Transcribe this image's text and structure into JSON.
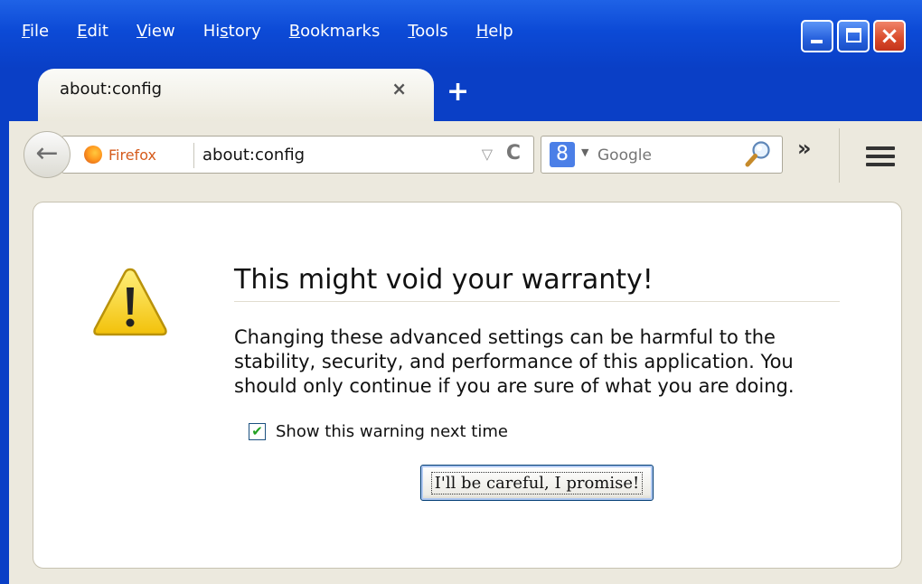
{
  "menubar": {
    "items": [
      {
        "accel": "F",
        "rest": "ile"
      },
      {
        "accel": "E",
        "rest": "dit"
      },
      {
        "accel": "V",
        "rest": "iew"
      },
      {
        "pre": "Hi",
        "accel": "s",
        "rest": "tory"
      },
      {
        "accel": "B",
        "rest": "ookmarks"
      },
      {
        "accel": "T",
        "rest": "ools"
      },
      {
        "accel": "H",
        "rest": "elp"
      }
    ]
  },
  "window_controls": {
    "minimize": "minimize",
    "maximize": "maximize",
    "close": "×"
  },
  "tab": {
    "title": "about:config",
    "close": "×"
  },
  "newtab": "+",
  "navbar": {
    "back": "←",
    "identity_label": "Firefox",
    "url": "about:config",
    "url_dropdown": "▽",
    "reload": "C",
    "search_engine_glyph": "8",
    "search_dropdown": "▼",
    "search_placeholder": "Google",
    "overflow": "»"
  },
  "warning": {
    "title": "This might void your warranty!",
    "body": "Changing these advanced settings can be harmful to the stability, security, and performance of this application. You should only continue if you are sure of what you are doing.",
    "checkbox_label": "Show this warning next time",
    "checkbox_checked": true,
    "checkmark": "✔",
    "button_label": "I'll be careful, I promise!"
  }
}
